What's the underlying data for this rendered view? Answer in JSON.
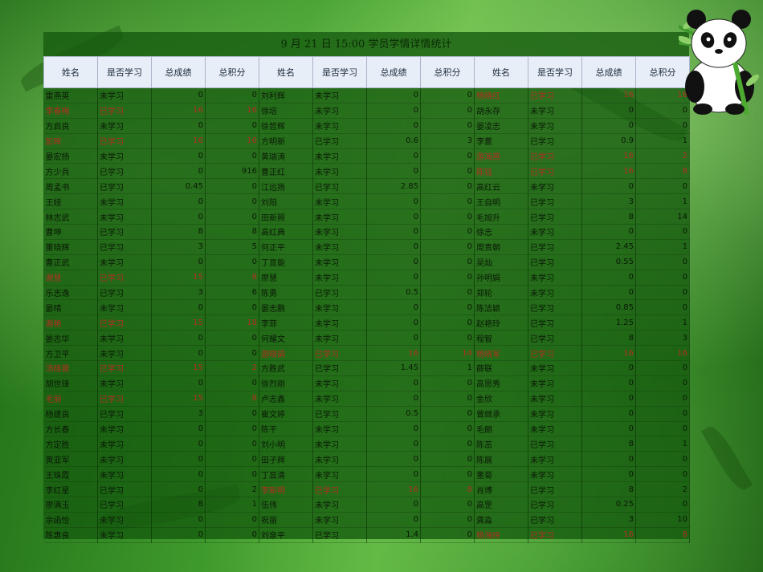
{
  "title": "9 月 21 日 15:00 学员学情详情统计",
  "headers": [
    "姓名",
    "是否学习",
    "总成绩",
    "总积分",
    "姓名",
    "是否学习",
    "总成绩",
    "总积分",
    "姓名",
    "是否学习",
    "总成绩",
    "总积分"
  ],
  "highlight_color": "#b23020",
  "rows": [
    [
      [
        "雷燕英",
        "未学习",
        "0",
        "0"
      ],
      [
        "刘利辉",
        "未学习",
        "0",
        "0"
      ],
      [
        "杨晓红",
        "已学习",
        "16",
        "16"
      ]
    ],
    [
      [
        "李春梅",
        "已学习",
        "16",
        "16"
      ],
      [
        "徐培",
        "未学习",
        "0",
        "0"
      ],
      [
        "胡永存",
        "未学习",
        "0",
        "0"
      ]
    ],
    [
      [
        "方启良",
        "未学习",
        "0",
        "0"
      ],
      [
        "徐哲辉",
        "未学习",
        "0",
        "0"
      ],
      [
        "晏凌志",
        "未学习",
        "0",
        "0"
      ]
    ],
    [
      [
        "彭晖",
        "已学习",
        "16",
        "16"
      ],
      [
        "方明新",
        "已学习",
        "0.6",
        "3"
      ],
      [
        "李蕾",
        "已学习",
        "0.9",
        "1"
      ]
    ],
    [
      [
        "晏宏扬",
        "未学习",
        "0",
        "0"
      ],
      [
        "黄瑞涛",
        "未学习",
        "0",
        "0"
      ],
      [
        "游海燕",
        "已学习",
        "16",
        "2"
      ]
    ],
    [
      [
        "方少兵",
        "已学习",
        "0",
        "916"
      ],
      [
        "曹正红",
        "未学习",
        "0",
        "0"
      ],
      [
        "陈钰",
        "已学习",
        "16",
        "8"
      ]
    ],
    [
      [
        "周孟书",
        "已学习",
        "0.45",
        "0"
      ],
      [
        "江远扬",
        "已学习",
        "2.85",
        "0"
      ],
      [
        "高红云",
        "未学习",
        "0",
        "0"
      ]
    ],
    [
      [
        "王娅",
        "未学习",
        "0",
        "0"
      ],
      [
        "刘阳",
        "未学习",
        "0",
        "0"
      ],
      [
        "王自明",
        "已学习",
        "3",
        "1"
      ]
    ],
    [
      [
        "林志武",
        "未学习",
        "0",
        "0"
      ],
      [
        "田新照",
        "未学习",
        "0",
        "0"
      ],
      [
        "毛旭升",
        "已学习",
        "8",
        "14"
      ]
    ],
    [
      [
        "曹坤",
        "已学习",
        "8",
        "8"
      ],
      [
        "高红典",
        "未学习",
        "0",
        "0"
      ],
      [
        "徐志",
        "未学习",
        "0",
        "0"
      ]
    ],
    [
      [
        "董晓辉",
        "已学习",
        "3",
        "5"
      ],
      [
        "何正平",
        "未学习",
        "0",
        "0"
      ],
      [
        "周贵朝",
        "已学习",
        "2.45",
        "1"
      ]
    ],
    [
      [
        "曹正武",
        "未学习",
        "0",
        "0"
      ],
      [
        "丁显能",
        "未学习",
        "0",
        "0"
      ],
      [
        "吴灿",
        "已学习",
        "0.55",
        "0"
      ]
    ],
    [
      [
        "谢慧",
        "已学习",
        "15",
        "8"
      ],
      [
        "廖慧",
        "未学习",
        "0",
        "0"
      ],
      [
        "孙明娟",
        "未学习",
        "0",
        "0"
      ]
    ],
    [
      [
        "乐志逸",
        "已学习",
        "3",
        "6"
      ],
      [
        "陈勇",
        "已学习",
        "0.5",
        "0"
      ],
      [
        "郑轮",
        "未学习",
        "0",
        "0"
      ]
    ],
    [
      [
        "晏晴",
        "未学习",
        "0",
        "0"
      ],
      [
        "晏志鹏",
        "未学习",
        "0",
        "0"
      ],
      [
        "陈洁颖",
        "已学习",
        "0.85",
        "0"
      ]
    ],
    [
      [
        "谢艳",
        "已学习",
        "15",
        "18"
      ],
      [
        "李菲",
        "未学习",
        "0",
        "0"
      ],
      [
        "赵艳玲",
        "已学习",
        "1.25",
        "1"
      ]
    ],
    [
      [
        "晏志华",
        "未学习",
        "0",
        "0"
      ],
      [
        "何耀文",
        "未学习",
        "0",
        "0"
      ],
      [
        "程智",
        "已学习",
        "8",
        "3"
      ]
    ],
    [
      [
        "方卫平",
        "未学习",
        "0",
        "0"
      ],
      [
        "游晓娟",
        "已学习",
        "16",
        "14"
      ],
      [
        "杨晓军",
        "已学习",
        "16",
        "16"
      ]
    ],
    [
      [
        "汤晓蓉",
        "已学习",
        "15",
        "2"
      ],
      [
        "方胜武",
        "已学习",
        "1.45",
        "1"
      ],
      [
        "薛联",
        "未学习",
        "0",
        "0"
      ]
    ],
    [
      [
        "胡世锋",
        "未学习",
        "0",
        "0"
      ],
      [
        "徐烈刚",
        "未学习",
        "0",
        "0"
      ],
      [
        "高思秀",
        "未学习",
        "0",
        "0"
      ]
    ],
    [
      [
        "毛丽",
        "已学习",
        "15",
        "8"
      ],
      [
        "卢志鑫",
        "未学习",
        "0",
        "0"
      ],
      [
        "金欣",
        "未学习",
        "0",
        "0"
      ]
    ],
    [
      [
        "杨建良",
        "已学习",
        "3",
        "0"
      ],
      [
        "崔文婷",
        "已学习",
        "0.5",
        "0"
      ],
      [
        "曾继承",
        "未学习",
        "0",
        "0"
      ]
    ],
    [
      [
        "方长春",
        "未学习",
        "0",
        "0"
      ],
      [
        "陈干",
        "未学习",
        "0",
        "0"
      ],
      [
        "毛朗",
        "未学习",
        "0",
        "0"
      ]
    ],
    [
      [
        "方定胜",
        "未学习",
        "0",
        "0"
      ],
      [
        "刘小明",
        "未学习",
        "0",
        "0"
      ],
      [
        "陈茁",
        "已学习",
        "8",
        "1"
      ]
    ],
    [
      [
        "黄亚军",
        "未学习",
        "0",
        "0"
      ],
      [
        "田子辉",
        "未学习",
        "0",
        "0"
      ],
      [
        "陈展",
        "未学习",
        "0",
        "0"
      ]
    ],
    [
      [
        "王珠霞",
        "未学习",
        "0",
        "0"
      ],
      [
        "丁显清",
        "未学习",
        "0",
        "0"
      ],
      [
        "董菊",
        "未学习",
        "0",
        "0"
      ]
    ],
    [
      [
        "李红星",
        "已学习",
        "0",
        "2"
      ],
      [
        "李新明",
        "已学习",
        "16",
        "8"
      ],
      [
        "肖博",
        "已学习",
        "8",
        "2"
      ]
    ],
    [
      [
        "廖满玉",
        "已学习",
        "8",
        "1"
      ],
      [
        "伍伟",
        "未学习",
        "0",
        "0"
      ],
      [
        "高罡",
        "已学习",
        "0.25",
        "0"
      ]
    ],
    [
      [
        "余函怡",
        "未学习",
        "0",
        "0"
      ],
      [
        "祝丽",
        "未学习",
        "0",
        "0"
      ],
      [
        "龚淼",
        "已学习",
        "3",
        "10"
      ]
    ],
    [
      [
        "陈惠良",
        "未学习",
        "0",
        "0"
      ],
      [
        "刘泉平",
        "已学习",
        "1.4",
        "0"
      ],
      [
        "杨海玲",
        "已学习",
        "16",
        "8"
      ]
    ]
  ],
  "red_cells": [
    [
      1,
      0
    ],
    [
      3,
      0
    ],
    [
      12,
      0
    ],
    [
      15,
      0
    ],
    [
      18,
      0
    ],
    [
      20,
      0
    ],
    [
      17,
      1
    ],
    [
      26,
      1
    ],
    [
      0,
      2
    ],
    [
      4,
      2
    ],
    [
      5,
      2
    ],
    [
      17,
      2
    ],
    [
      29,
      2
    ]
  ]
}
